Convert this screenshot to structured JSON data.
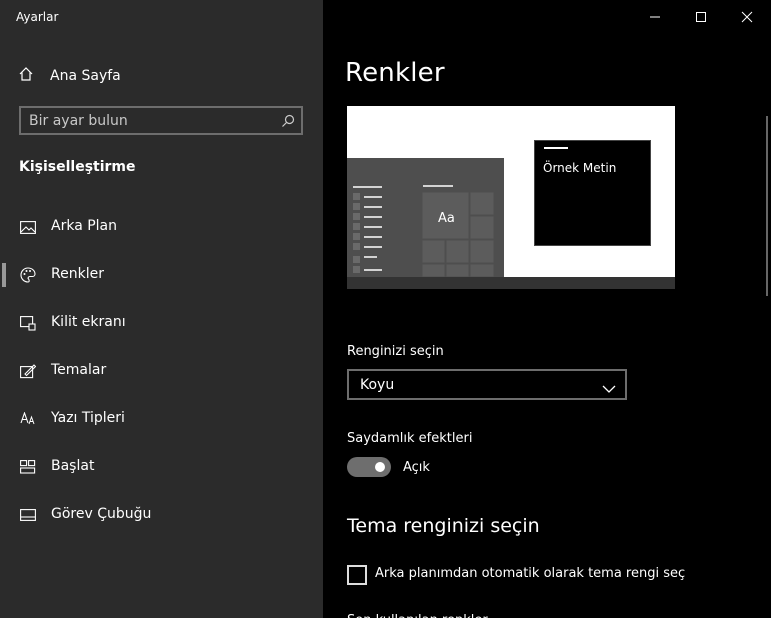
{
  "window": {
    "title": "Ayarlar",
    "controls": [
      "minimize",
      "maximize",
      "close"
    ]
  },
  "sidebar": {
    "home_label": "Ana Sayfa",
    "search_placeholder": "Bir ayar bulun",
    "section_title": "Kişiselleştirme",
    "items": [
      {
        "label": "Arka Plan",
        "icon": "image-icon",
        "active": false
      },
      {
        "label": "Renkler",
        "icon": "palette-icon",
        "active": true
      },
      {
        "label": "Kilit ekranı",
        "icon": "lock-screen-icon",
        "active": false
      },
      {
        "label": "Temalar",
        "icon": "themes-icon",
        "active": false
      },
      {
        "label": "Yazı Tipleri",
        "icon": "fonts-icon",
        "active": false
      },
      {
        "label": "Başlat",
        "icon": "start-icon",
        "active": false
      },
      {
        "label": "Görev Çubuğu",
        "icon": "taskbar-icon",
        "active": false
      }
    ]
  },
  "main": {
    "title": "Renkler",
    "preview": {
      "sample_text": "Örnek Metin",
      "tile_text": "Aa"
    },
    "color_choice": {
      "label": "Renginizi seçin",
      "value": "Koyu"
    },
    "transparency": {
      "label": "Saydamlık efektleri",
      "state_label": "Açık",
      "on": true
    },
    "accent_section_title": "Tema renginizi seçin",
    "auto_accent": {
      "label": "Arka planımdan otomatik olarak tema rengi seç",
      "checked": false
    },
    "cutoff_text": "Son kullanılan renkler"
  },
  "colors": {
    "sidebar_bg": "#2b2b2b",
    "main_bg": "#000000",
    "control_border": "#6d6d6d"
  }
}
